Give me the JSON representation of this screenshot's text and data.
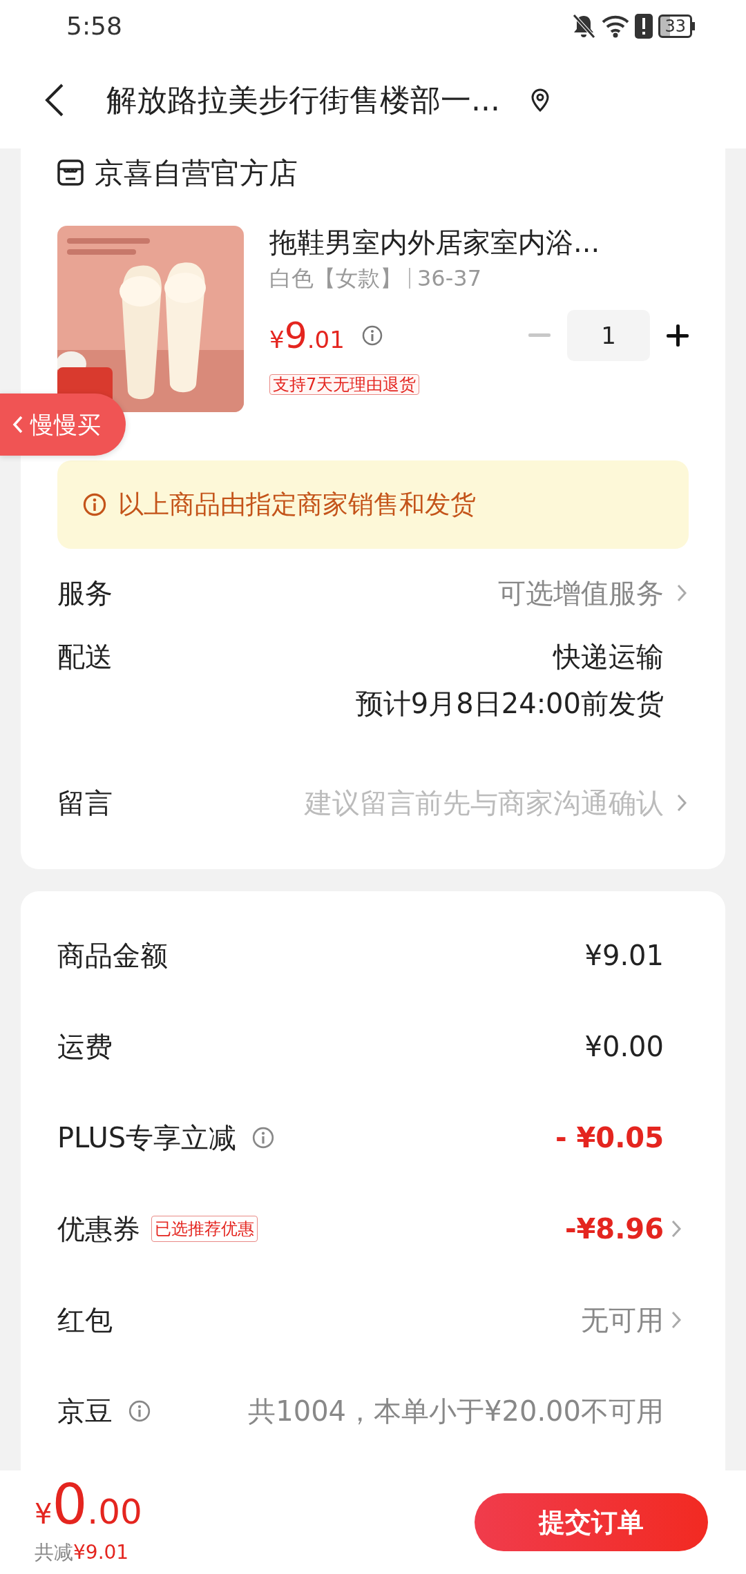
{
  "status_bar": {
    "time": "5:58",
    "battery": "33"
  },
  "header": {
    "title": "解放路拉美步行街售楼部一..."
  },
  "store": {
    "name": "京喜自营官方店"
  },
  "product": {
    "kind": "picture",
    "title": "拖鞋男室内外居家室内浴...",
    "spec": "白色【女款】",
    "size": "36-37",
    "price": {
      "currency": "¥",
      "integer": "9",
      "decimal": ".01"
    },
    "quantity": "1",
    "minus_disabled": true,
    "return_tag": "支持7天无理由退货"
  },
  "floating_button": {
    "label": "慢慢买"
  },
  "notice": {
    "text": "以上商品由指定商家销售和发货"
  },
  "order_rows": [
    {
      "label": "服务",
      "values": [
        "可选增值服务"
      ],
      "kind": "muted",
      "arrow": true
    },
    {
      "label": "配送",
      "values": [
        "快递运输",
        "预计9月8日24:00前发货"
      ],
      "kind": "plain",
      "arrow": false
    },
    {
      "label": "留言",
      "values": [
        "建议留言前先与商家沟通确认"
      ],
      "kind": "hint",
      "arrow": true
    }
  ],
  "summary_rows": [
    {
      "label": "商品金额",
      "info": false,
      "value": "¥9.01",
      "kind": "plain",
      "arrow": false
    },
    {
      "label": "运费",
      "info": false,
      "value": "¥0.00",
      "kind": "plain",
      "arrow": false
    },
    {
      "label": "PLUS专享立减",
      "info": true,
      "value": "- ¥0.05",
      "kind": "discount",
      "arrow": false
    },
    {
      "label": "优惠券",
      "info": false,
      "tag": "已选推荐优惠",
      "value": "-¥8.96",
      "kind": "discount",
      "arrow": true
    },
    {
      "label": "红包",
      "info": false,
      "value": "无可用",
      "kind": "muted",
      "arrow": true
    },
    {
      "label": "京豆",
      "info": true,
      "value": "共1004，本单小于¥20.00不可用",
      "kind": "muted",
      "arrow": false
    }
  ],
  "footer": {
    "total": {
      "currency": "¥",
      "integer": "0",
      "decimal": ".00"
    },
    "saved_label": "共减",
    "saved_amount": "¥9.01",
    "submit": "提交订单"
  }
}
